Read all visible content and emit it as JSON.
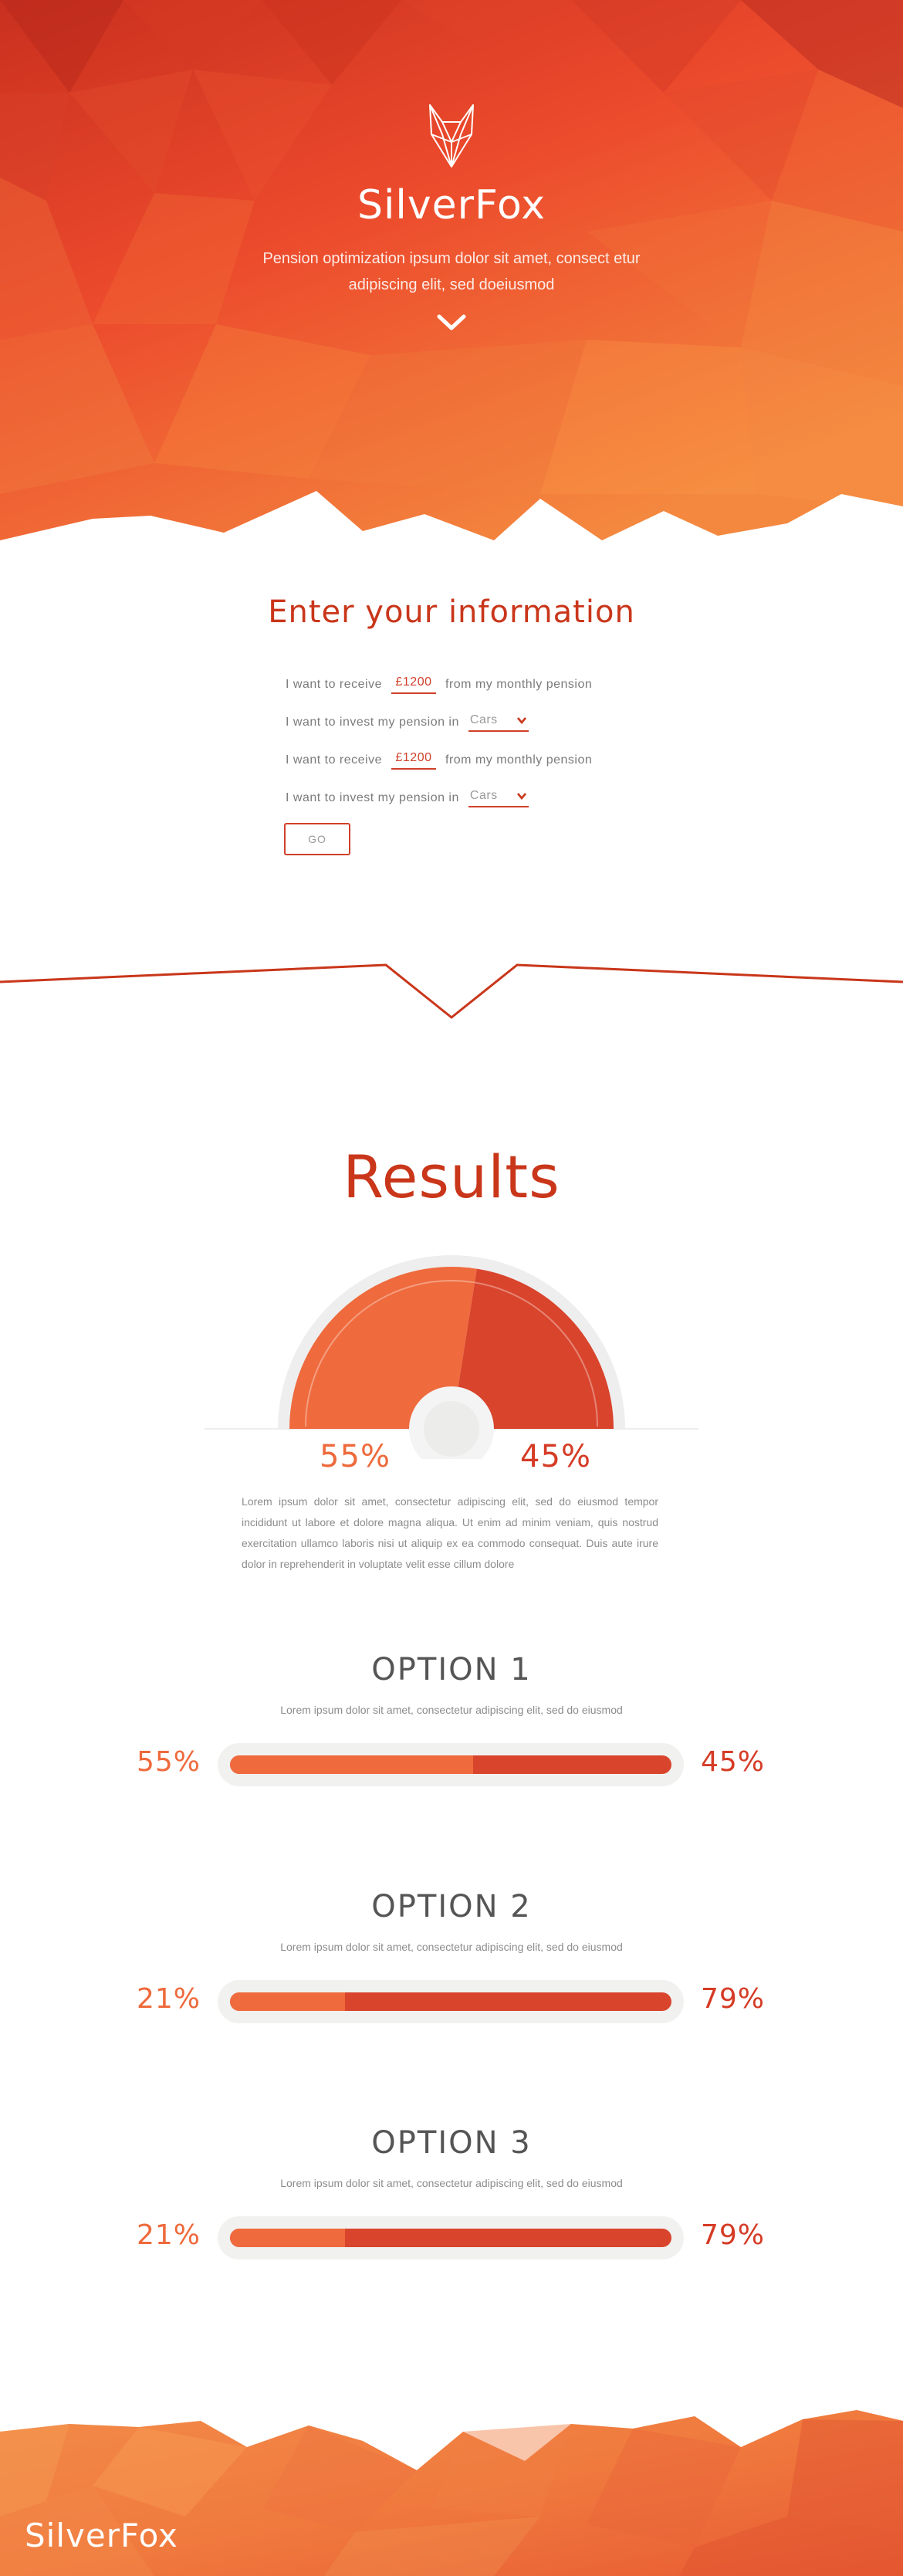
{
  "hero": {
    "title": "SilverFox",
    "subtitle": "Pension optimization ipsum dolor sit amet, consect etur adipiscing elit, sed doeiusmod",
    "logo_icon": "fox-head-icon",
    "scroll_icon": "chevron-down-icon"
  },
  "form": {
    "title": "Enter your information",
    "rows": [
      {
        "prefix": "I want to receive",
        "value": "£1200",
        "suffix": "from my monthly pension"
      },
      {
        "prefix": "I want to invest my pension in",
        "select": "Cars"
      },
      {
        "prefix": "I want to receive",
        "value": "£1200",
        "suffix": "from my monthly pension"
      },
      {
        "prefix": "I want to invest my pension in",
        "select": "Cars"
      }
    ],
    "go_label": "GO"
  },
  "results": {
    "title": "Results",
    "gauge": {
      "left_pct": 55,
      "right_pct": 45,
      "left_label": "55%",
      "right_label": "45%"
    },
    "paragraph": "Lorem ipsum dolor sit amet, consectetur adipiscing elit, sed do eiusmod tempor incididunt ut labore et dolore magna aliqua. Ut enim ad minim veniam, quis nostrud exercitation ullamco laboris nisi ut aliquip ex ea commodo consequat. Duis aute irure dolor in reprehenderit in voluptate velit esse cillum dolore"
  },
  "options": [
    {
      "title": "OPTION 1",
      "desc": "Lorem ipsum dolor sit amet, consectetur adipiscing elit, sed do eiusmod",
      "left_label": "55%",
      "right_label": "45%",
      "left_fraction": 0.55
    },
    {
      "title": "OPTION 2",
      "desc": "Lorem ipsum dolor sit amet, consectetur adipiscing elit, sed do eiusmod",
      "left_label": "21%",
      "right_label": "79%",
      "left_fraction": 0.26
    },
    {
      "title": "OPTION 3",
      "desc": "Lorem ipsum dolor sit amet, consectetur adipiscing elit, sed do eiusmod",
      "left_label": "21%",
      "right_label": "79%",
      "left_fraction": 0.26
    }
  ],
  "footer": {
    "brand": "SilverFox"
  },
  "colors": {
    "accent_dark": "#c9361a",
    "accent": "#d9442c",
    "accent_light": "#ef6a3d",
    "track": "#f1f1f0",
    "text_gray": "#7b7b7b"
  }
}
